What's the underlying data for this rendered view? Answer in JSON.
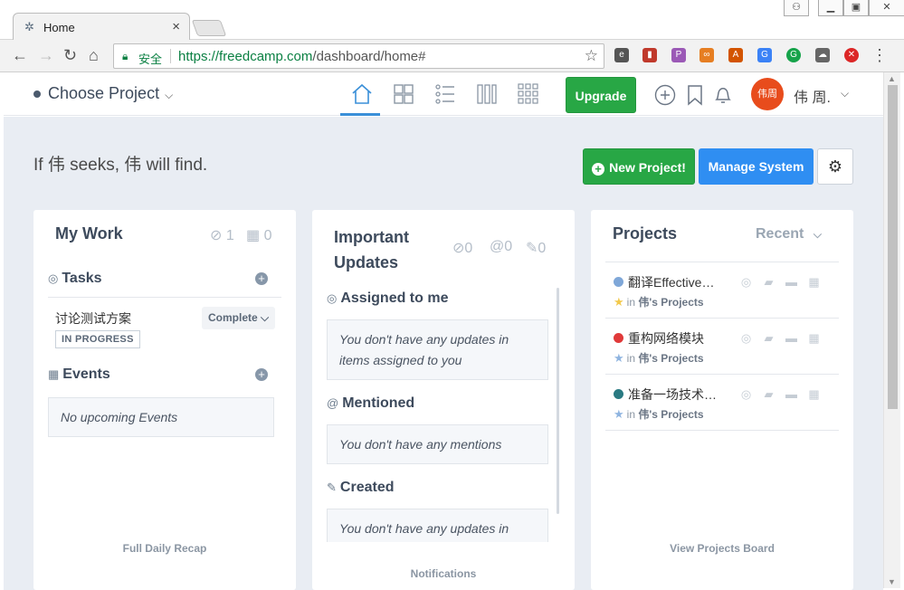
{
  "browser": {
    "tab_title": "Home",
    "secure_label": "安全",
    "url_host": "https://freedcamp.com",
    "url_path": "/dashboard/home#"
  },
  "header": {
    "project_selector": "Choose Project",
    "upgrade_label": "Upgrade",
    "avatar_text": "伟周",
    "user_name": "伟 周."
  },
  "page": {
    "tagline": "If 伟 seeks, 伟 will find.",
    "new_project_label": "New Project!",
    "manage_system_label": "Manage System"
  },
  "my_work": {
    "title": "My Work",
    "tasks_count": "1",
    "events_count": "0",
    "tasks_heading": "Tasks",
    "task_name": "讨论测试方案",
    "task_status": "IN PROGRESS",
    "task_action": "Complete",
    "events_heading": "Events",
    "events_empty": "No upcoming Events",
    "footer": "Full Daily Recap"
  },
  "updates": {
    "title_line1": "Important",
    "title_line2": "Updates",
    "assigned_count": "0",
    "mention_count": "0",
    "created_count": "0",
    "assigned_heading": "Assigned to me",
    "assigned_empty": "You don't have any updates in items assigned to you",
    "mentioned_heading": "Mentioned",
    "mentioned_empty": "You don't have any mentions",
    "created_heading": "Created",
    "created_empty": "You don't have any updates in",
    "footer": "Notifications"
  },
  "projects": {
    "title": "Projects",
    "filter": "Recent",
    "in_label": "in",
    "items": [
      {
        "name": "翻译EffectiveLea...",
        "owner": "伟's Projects",
        "color": "#7fa7d8",
        "star_color": "#f2c94c"
      },
      {
        "name": "重构网络模块",
        "owner": "伟's Projects",
        "color": "#e03a3a",
        "star_color": "#8fb4e0"
      },
      {
        "name": "准备一场技术分享",
        "owner": "伟's Projects",
        "color": "#2a7a82",
        "star_color": "#8fb4e0"
      }
    ],
    "footer": "View Projects Board"
  }
}
